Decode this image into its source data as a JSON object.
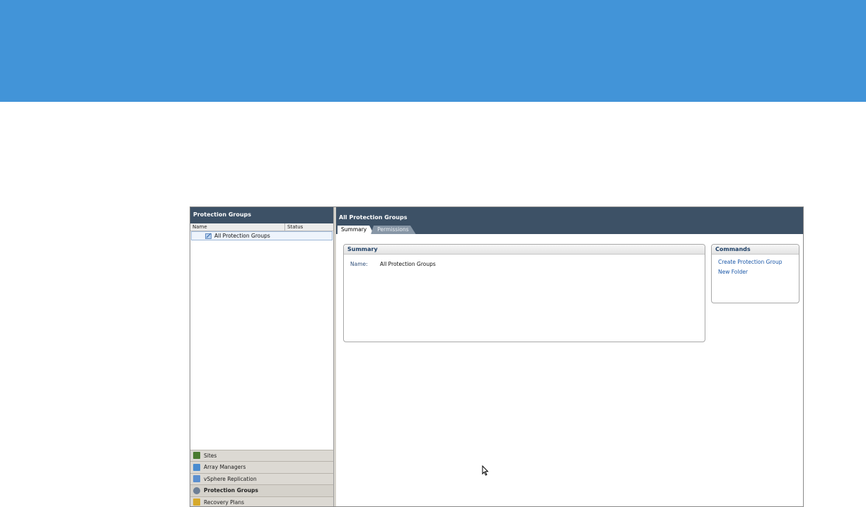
{
  "left_pane": {
    "header": "Protection Groups",
    "columns": [
      "Name",
      "Status"
    ],
    "tree_item": "All Protection Groups"
  },
  "nav_items": [
    {
      "label": "Sites",
      "icon": "sites-icon",
      "color": "#4a7b2f"
    },
    {
      "label": "Array Managers",
      "icon": "array-managers-icon",
      "color": "#4a8ccf"
    },
    {
      "label": "vSphere Replication",
      "icon": "vsphere-replication-icon",
      "color": "#5b8fcf"
    },
    {
      "label": "Protection Groups",
      "icon": "protection-groups-icon",
      "color": "#6d7f95"
    },
    {
      "label": "Recovery Plans",
      "icon": "recovery-plans-icon",
      "color": "#d6a92b"
    }
  ],
  "right_pane": {
    "title": "All Protection Groups",
    "tabs": [
      "Summary",
      "Permissions"
    ],
    "summary": {
      "heading": "Summary",
      "name_label": "Name:",
      "name_value": "All Protection Groups"
    },
    "commands": {
      "heading": "Commands",
      "items": [
        "Create Protection Group",
        "New Folder"
      ]
    }
  },
  "colors": {
    "banner": "#4294d8",
    "header": "#3d5166",
    "link": "#1a57a8"
  }
}
